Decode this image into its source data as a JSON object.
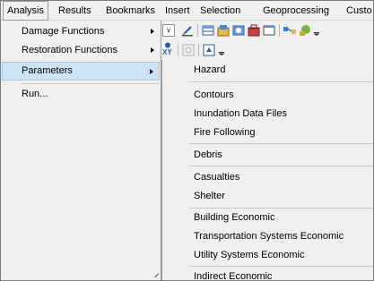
{
  "menubar": {
    "items": [
      "Analysis",
      "Results",
      "Bookmarks",
      "Insert",
      "Selection",
      "Geoprocessing",
      "Custo"
    ]
  },
  "analysis_menu": {
    "items": [
      {
        "label": "Damage Functions",
        "submenu": true
      },
      {
        "label": "Restoration Functions",
        "submenu": true
      },
      {
        "label": "Parameters",
        "submenu": true,
        "highlighted": true
      },
      {
        "label": "Run...",
        "submenu": false
      }
    ]
  },
  "parameters_submenu": {
    "groups": [
      [
        "Hazard"
      ],
      [
        "Contours",
        "Inundation Data Files",
        "Fire Following"
      ],
      [
        "Debris"
      ],
      [
        "Casualties",
        "Shelter"
      ],
      [
        "Building Economic",
        "Transportation Systems Economic",
        "Utility Systems Economic"
      ],
      [
        "Indirect Economic"
      ]
    ]
  },
  "toolbar": {
    "xy_label": "XY",
    "dropdown_glyph": "∨"
  },
  "colors": {
    "menu_bg": "#f0f0f0",
    "highlight_bg": "#cce4f7",
    "highlight_border": "#99c9ef"
  }
}
